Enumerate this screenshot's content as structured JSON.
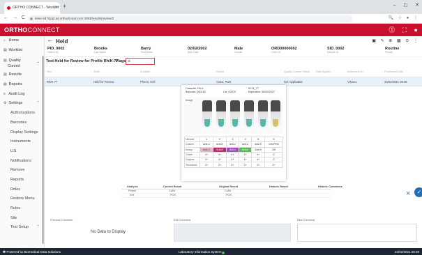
{
  "browser": {
    "tab_title": "ORTHO CONNECT - Worklist",
    "tab_close": "×",
    "new_tab": "+",
    "window_controls": "– ◻ ✕",
    "nav": "← → C ⌂",
    "url": "inme-2d7syq2.ad.orthoclinical.com:4093/results/review/3",
    "toolbar_icons": "🔍 ☆ ● ⋮"
  },
  "app": {
    "logo_main": "ORTHO",
    "logo_thin": "CONNECT",
    "header_icons": "⓵ ⛶ ●"
  },
  "sidebar": {
    "items": [
      {
        "icon": "⌂",
        "label": "Home"
      },
      {
        "icon": "▤",
        "label": "Worklist"
      },
      {
        "icon": "",
        "label": "Quality",
        "label2": "Control",
        "caret": "⌄"
      },
      {
        "icon": "▤",
        "label": "Results"
      },
      {
        "icon": "▤",
        "label": "Reports"
      },
      {
        "icon": "≡",
        "label": "Audit Log"
      },
      {
        "icon": "⚙",
        "label": "Settings",
        "caret": "⌃"
      },
      {
        "label": "Authorizations"
      },
      {
        "label": "Barcodes"
      },
      {
        "label": "Display Settings"
      },
      {
        "label": "Instruments"
      },
      {
        "label": "LIS"
      },
      {
        "label": "Notifications"
      },
      {
        "label": "Remove"
      },
      {
        "label": "Reports"
      },
      {
        "label": "Roles"
      },
      {
        "label": "Restore Menu"
      },
      {
        "label": "Rules"
      },
      {
        "label": "Site"
      },
      {
        "label": "Test Setup",
        "caret": "⌃"
      }
    ]
  },
  "held": {
    "back": "←",
    "title": "Held",
    "tools": "▣ ✎ ⊕ ▦ ⊙ ⋮"
  },
  "patient": {
    "fields": [
      {
        "value": "PID_0002",
        "label": "Patient ID"
      },
      {
        "value": "Brooks",
        "label": "Last Name"
      },
      {
        "value": "Barry",
        "label": "First Name"
      },
      {
        "value": "02/02/2002",
        "label": "Birth Date"
      },
      {
        "value": "Male",
        "label": "Gender"
      },
      {
        "value": "ORD00000002",
        "label": "Order ID"
      },
      {
        "value": "SID_0002",
        "label": "Sample ID"
      },
      {
        "value": "Routine",
        "label": "Priority"
      }
    ]
  },
  "flag_row": {
    "label": "Test Held for Review for Profile Rh/K-77",
    "flags_label": "Flags",
    "flags_value": "s"
  },
  "table": {
    "headers": [
      "Test",
      "State",
      "Analysis",
      "Result",
      "Quality Control Status",
      "Date Applied",
      "Instrument ID",
      "Processed Date"
    ],
    "row": [
      "Rh/K-77",
      "Held for Review",
      "Pheno, Kell",
      "CcEe, POS",
      "Not Applicable",
      "",
      "Vision1",
      "24/02/2021 09:35"
    ]
  },
  "popup": {
    "cassette_line1": "Cassette: Rh-K",
    "cassette_line2": "Barcode: 000102",
    "lot": "Lot: 00979",
    "id_line1": "ID: B_77",
    "id_line2": "Expiration: 30/09/2027",
    "image_label": "Image",
    "rows": [
      {
        "head": "Number",
        "cells": [
          "1",
          "2",
          "3",
          "4",
          "5",
          "6"
        ]
      },
      {
        "head": "Column",
        "cells": [
          "Anti-C",
          "Anti-E",
          "Anti-c",
          "Anti-e",
          "Anti-K",
          "Ctrl-PRO"
        ]
      },
      {
        "head": "Assay",
        "cells": [
          "Anti-C",
          "Anti-E",
          "Anti-c",
          "Anti-e",
          "Anti-K",
          "Ctrl"
        ]
      },
      {
        "head": "Grade",
        "cells": [
          "4+",
          "4+",
          "4+",
          "4+",
          "4+",
          "0"
        ]
      },
      {
        "head": "Original",
        "cells": [
          "4+",
          "4+",
          "4+",
          "4+",
          "4+",
          "0"
        ]
      },
      {
        "head": "Threshold",
        "cells": [
          "2+",
          "2+",
          "2+",
          "2+",
          "2+",
          "2+"
        ]
      }
    ]
  },
  "analysis": {
    "headers": [
      "Analysis",
      "Current Result",
      "Original Result",
      "Historic Result",
      "Historic Comments"
    ],
    "rows": [
      [
        "Pheno",
        "CcEe",
        "CcEe",
        "",
        ""
      ],
      [
        "Kell",
        "POS",
        "POS",
        "",
        ""
      ]
    ]
  },
  "comments": {
    "previous": "Previous Comment",
    "no_data": "No Data to Display",
    "edit": "Edit Comment",
    "new": "New Comment"
  },
  "actions": {
    "cancel": "×",
    "accept": "✓"
  },
  "status": {
    "left": "Powered by Biomedical Data Solutions",
    "center": "Laboratory Information System",
    "right": "24/02/2021 09:39"
  },
  "colors": {
    "brand": "#c8102e",
    "accent": "#1f6fb5",
    "status_bar": "#1d2733"
  }
}
